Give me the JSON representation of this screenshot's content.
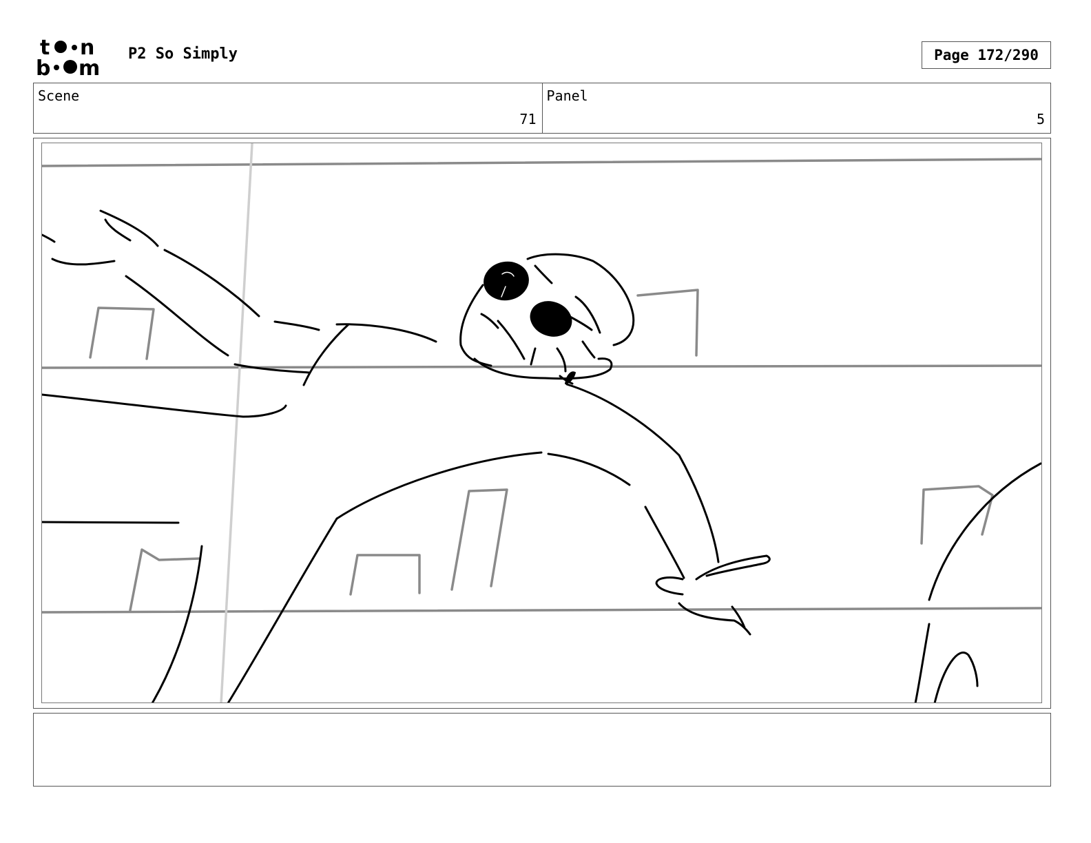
{
  "header": {
    "logo_text": "toon boom",
    "title": "P2 So Simply",
    "page_label": "Page 172/290"
  },
  "info": {
    "scene_label": "Scene",
    "scene_value": "71",
    "panel_label": "Panel",
    "panel_value": "5"
  },
  "notes": {
    "text": ""
  }
}
